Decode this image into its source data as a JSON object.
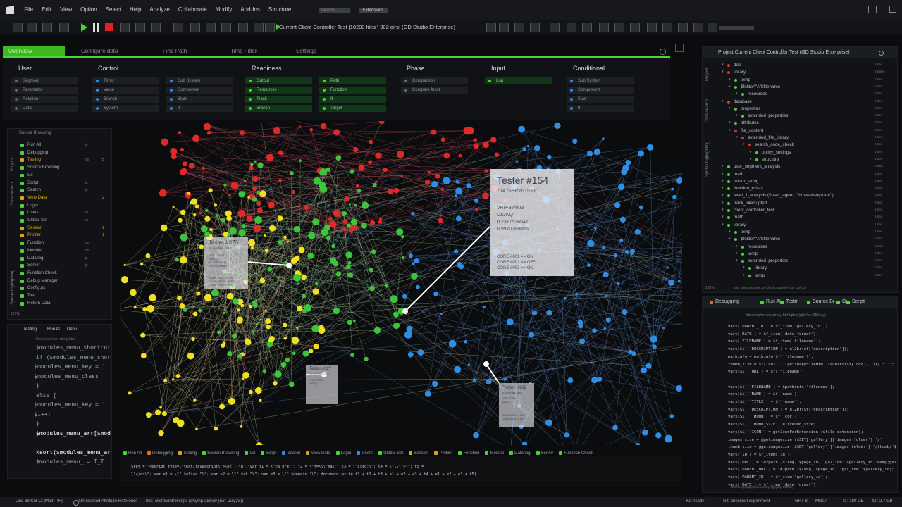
{
  "menu": [
    "File",
    "Edit",
    "View",
    "Option",
    "Select",
    "Help",
    "Analyze",
    "Collaborate",
    "Modify",
    "Add-Ins",
    "Structure"
  ],
  "search_placeholder": "Search",
  "extensions_label": "Extensions",
  "run_info": "Current Client Controller Test  [10293 files \\ 302 dirs]  (GD Studio Enterprise)",
  "tabs": [
    "Overview",
    "Configure data",
    "Find Path",
    "Time Filter",
    "Settings"
  ],
  "filters": {
    "user": {
      "title": "User",
      "items": [
        "Segment",
        "Parameter",
        "Relation",
        "Data"
      ]
    },
    "control": {
      "title": "Control",
      "col1": [
        "Timer",
        "Value",
        "Branch",
        "System"
      ],
      "col2": [
        "Sub System",
        "Component",
        "Start",
        "If"
      ]
    },
    "readiness": {
      "title": "Readiness",
      "col1": [
        "Output",
        "Resources",
        "Track",
        "Branch"
      ],
      "col2": [
        "Path",
        "Function",
        "If",
        "Target"
      ]
    },
    "phase": {
      "title": "Phase",
      "items": [
        "Comparison",
        "Compare funct"
      ]
    },
    "input": {
      "title": "Input",
      "items": [
        "Log"
      ]
    },
    "conditional": {
      "title": "Conditional",
      "items": [
        "Sub System",
        "Component",
        "Start",
        "If"
      ]
    }
  },
  "source_panel": {
    "title": "Source Browsing",
    "side_labels": [
      "Syntax highlighting",
      "Code search",
      "Project"
    ],
    "items": [
      {
        "label": "Run All",
        "color": "#4cd137",
        "tag": "js",
        "count": ""
      },
      {
        "label": "Debugging",
        "color": "#4cd137",
        "tag": "",
        "count": ""
      },
      {
        "label": "Testing",
        "color": "#e0a020",
        "tag": "cs",
        "count": "5"
      },
      {
        "label": "Source Browsing",
        "color": "#4cd137",
        "tag": "",
        "count": ""
      },
      {
        "label": "Git",
        "color": "#4cd137",
        "tag": "",
        "count": ""
      },
      {
        "label": "Script",
        "color": "#4cd137",
        "tag": "js",
        "count": ""
      },
      {
        "label": "Search",
        "color": "#4cd137",
        "tag": "js",
        "count": ""
      },
      {
        "label": "View Data",
        "color": "#e0a020",
        "tag": "",
        "count": "2"
      },
      {
        "label": "Login",
        "color": "#4cd137",
        "tag": "",
        "count": ""
      },
      {
        "label": "Users",
        "color": "#4cd137",
        "tag": "m",
        "count": ""
      },
      {
        "label": "Global Set",
        "color": "#4cd137",
        "tag": "m",
        "count": ""
      },
      {
        "label": "Session",
        "color": "#e0a020",
        "tag": "",
        "count": "1"
      },
      {
        "label": "Profiler",
        "color": "#e0a020",
        "tag": "",
        "count": "1"
      },
      {
        "label": "Function",
        "color": "#4cd137",
        "tag": "cs",
        "count": ""
      },
      {
        "label": "Module",
        "color": "#4cd137",
        "tag": "cs",
        "count": ""
      },
      {
        "label": "Data log",
        "color": "#4cd137",
        "tag": "js",
        "count": ""
      },
      {
        "label": "Server",
        "color": "#4cd137",
        "tag": "js",
        "count": ""
      },
      {
        "label": "Function Check",
        "color": "#4cd137",
        "tag": "",
        "count": ""
      },
      {
        "label": "Debug Manager",
        "color": "#4cd137",
        "tag": "",
        "count": ""
      },
      {
        "label": "Config.px",
        "color": "#4cd137",
        "tag": "",
        "count": ""
      },
      {
        "label": "Test",
        "color": "#4cd137",
        "tag": "",
        "count": ""
      },
      {
        "label": "Return Data",
        "color": "#4cd137",
        "tag": "",
        "count": ""
      }
    ],
    "zoom": "120%"
  },
  "left_code": {
    "tabs": [
      "Testing",
      "Run Al",
      "Debu"
    ],
    "path": "libraries/return string html",
    "lines": [
      "$modules_menu_shortcuts_k",
      "if ($modules_menu_shortcuts_",
      "    $modules_menu_key = '",
      "    $modules_menu_class",
      "}",
      "else {",
      "    $modules_menu_key = '",
      "    $i++;",
      "}",
      "$modules_menu_arr[$module",
      "",
      "ksort($modules_menu_arr, SORT_N",
      "$modules_menu_ = T_T 'sub' N"
    ]
  },
  "graph": {
    "cards": [
      {
        "title": "Tester #154",
        "sub": "Z14 /SERW-1533/",
        "lines": [
          "VRP-37/003",
          "Da3KQ",
          "0.2377536541",
          "0.9970788855"
        ],
        "cores": [
          "CORE #001 >> ON",
          "CORE #002 >> OFF",
          "CORE #003 >> ON"
        ]
      },
      {
        "title": "Tester #073",
        "sub": "Z14 /SERW-1533/",
        "lines": [
          "VRP-37/003",
          "Da3KQ",
          "0.2377536541",
          "0.9970788855"
        ],
        "cores": [
          "CORE #001 >> ON",
          "CORE #002 >> OFF",
          "CORE #003 >> ON"
        ]
      },
      {
        "title": "Tester #327",
        "sub": "Z14 /SERW-1533/",
        "lines": [
          "VRP-37/003",
          "Da3KQ"
        ],
        "cores": []
      },
      {
        "title": "Tester #162",
        "sub": "Z14 /SERW-1533/",
        "lines": [
          "VRP-37/003",
          "Da3KQ"
        ],
        "cores": [
          "CORE #001 >> ON",
          "CORE #002 >> OFF"
        ]
      }
    ]
  },
  "bottom_tabs": [
    "Run All",
    "Debugging",
    "Testing",
    "Source Browsing",
    "Git",
    "Script",
    "Search",
    "View Data",
    "Login",
    "Users",
    "Global Set",
    "Session",
    "Profiler",
    "Function",
    "Module",
    "Data log",
    "Server",
    "Function Check"
  ],
  "bottom_code": [
    "$ret = \"<script type=\\\"text/javascript\\\">\\n<!--\\n\".\"var t1 = \\\"<a hre\\\"; t2 = \\\"f=\\\\\\\"ma\\\"; t3 = \\\"ilto:\\\"; t4 = \\\"\\\\\\\">\\\"; t5 =",
    "\\\"</a>\\\"; var e1 = \\\"\".$alias.\"\\\"; var e2 = \\\"\".$at.\"\\\"; var e3 = \\\"\".$domain.\"\\\"; document.write(t1 + t2 + t3 + e1 + e2 + e3 + t4 + e1 + e2 + e3 + t5)"
  ],
  "project_panel": {
    "title": "Project Current Client Controller Test  (GD Studio Enterprise)",
    "side_labels": [
      "Project",
      "Code search",
      "Syntax highlighting"
    ],
    "tree": [
      {
        "label": "doc",
        "indent": 0,
        "color": "#e03030",
        "count": "1 sec"
      },
      {
        "label": "library",
        "indent": 0,
        "color": "#e03030",
        "count": "2 msec"
      },
      {
        "label": "temp",
        "indent": 1,
        "color": "#4cd137",
        "count": "1 sec"
      },
      {
        "label": "$folder\\\"/\\\"$filename",
        "indent": 1,
        "color": "#4cd137",
        "count": "1 sec"
      },
      {
        "label": "resourses",
        "indent": 2,
        "color": "#4cd137",
        "count": "1 sec"
      },
      {
        "label": "database",
        "indent": 0,
        "color": "#e03030",
        "count": "1 sec"
      },
      {
        "label": "properties",
        "indent": 1,
        "color": "#4cd137",
        "count": "1 sec"
      },
      {
        "label": "extended_properties",
        "indent": 2,
        "color": "#4cd137",
        "count": "1 sec"
      },
      {
        "label": "attributes",
        "indent": 1,
        "color": "#4cd137",
        "count": "4 sec"
      },
      {
        "label": "file_content",
        "indent": 1,
        "color": "#e03030",
        "count": "1 sec"
      },
      {
        "label": "extended_file_library",
        "indent": 2,
        "color": "#e03030",
        "count": "1 sec"
      },
      {
        "label": "search_code_check",
        "indent": 3,
        "color": "#e03030",
        "count": "6 sec"
      },
      {
        "label": "policy_settings",
        "indent": 4,
        "color": "#4cd137",
        "count": "1 sec"
      },
      {
        "label": "structure",
        "indent": 4,
        "color": "#4cd137",
        "count": "1 sec"
      },
      {
        "label": "user_segment_analysis",
        "indent": 0,
        "color": "#4cd137",
        "count": "5 msc"
      },
      {
        "label": "math",
        "indent": 0,
        "color": "#4cd137",
        "count": "1 sec"
      },
      {
        "label": "return_string",
        "indent": 0,
        "color": "#4cd137",
        "count": "1 sec"
      },
      {
        "label": "function_exists",
        "indent": 0,
        "color": "#4cd137",
        "count": "1 sec"
      },
      {
        "label": "level_1_analysis ($user_agent, \"ibm-webexplorer\")",
        "indent": 0,
        "color": "#4cd137",
        "count": "1 sec"
      },
      {
        "label": "track_interrupted",
        "indent": 0,
        "color": "#4cd137",
        "count": "1 sec"
      },
      {
        "label": "client_controller_test",
        "indent": 0,
        "color": "#4cd137",
        "count": "1 sec"
      },
      {
        "label": "math",
        "indent": 0,
        "color": "#4cd137",
        "count": "1 sec"
      },
      {
        "label": "library",
        "indent": 0,
        "color": "#4cd137",
        "count": "1 sec"
      },
      {
        "label": "temp",
        "indent": 1,
        "color": "#4cd137",
        "count": "1 sec"
      },
      {
        "label": "$folder\\\"/\\\"$filename",
        "indent": 1,
        "color": "#4cd137",
        "count": "1 sec"
      },
      {
        "label": "resourses",
        "indent": 2,
        "color": "#4cd137",
        "count": "6 msc"
      },
      {
        "label": "temp",
        "indent": 2,
        "color": "#4cd137",
        "count": "1 sec"
      },
      {
        "label": "extended_properties",
        "indent": 2,
        "color": "#4cd137",
        "count": "1 sec"
      },
      {
        "label": "library",
        "indent": 3,
        "color": "#4cd137",
        "count": "1 sec"
      },
      {
        "label": "temp",
        "indent": 3,
        "color": "#4cd137",
        "count": "1 sec"
      }
    ],
    "footer": "test_clientcontroller.px (ghy/hp-25\\hay) [run_July23]",
    "zoom": "120%"
  },
  "right_code": {
    "tabs": [
      "Debugging",
      "Run Al",
      "Testin",
      "Source Br",
      "Gi",
      "Script"
    ],
    "path": "libraries/return string.html.php (ghy/hp-25\\hay)",
    "lines": [
      "vars['PARENT_ID'] = $f_item['gallery_id'];",
      "vars['DATE'] = $f_item['date_format'];",
      "vars['FILENAME'] = $f_item['filename'];",
      "vars[$i]['DESCRIPTION'] = nl2br($f['description']);",
      "pathinfo = pathinfo($f['filename']);",
      "thumb_size = $f['cor'] ? getImageSizeHtml (substr($f['cor'], 1)) : '';",
      "vars[$i]['URL'] = $f['filename'];",
      "",
      "vars[$i]['FILENAME'] = $pathinfo['filename'];",
      "vars[$i]['NAME'] = $f['name'];",
      "vars[$i]['TITLE'] = $f['name'];",
      "vars[$i]['DESCRIPTION'] = nl2br($f['description']);",
      "vars[$i]['THUMB'] = $f['cor'];",
      "vars[$i]['THUMB_SIZE'] = $thumb_size;",
      "vars[$i]['ICON'] = getIconForExtension ($file_extension);",
      "images_size = @getimagesize ($SET['gallery']['images_folder'] '/'",
      "thumb_size = @getimagesize ($SET['gallery']['images_folder'] '/thumb/'$f_item",
      "vars['ID'] = $f_item['id'];",
      "vars['URL'] = id2path ($lang, $page_id, 'gal_id='.$gallery_id.'&amp;gal",
      "vars['PARENT_URL'] = id2path ($lang, $page_id, 'gal_id='.$gallery_id);",
      "vars['PARENT_ID'] = $f_item['gallery_id'];",
      "vars['DATE'] = $f_item['date_format'];"
    ],
    "footer": "libraries/geoip/geoip.inc.php (ghy/hp-25\\hay)"
  },
  "status": {
    "line_col": "Line 89 Col 12 [Main PH]",
    "warning": "Unresolved Attribute Reference",
    "file": "test_clientcontroller.px (ghy/hp-25\\hay (run_July23))",
    "kit": "Kit: ready",
    "git": "Git: checkout experiment",
    "ght": "GHT-8",
    "mr": "MR07",
    "c": "C : 180 GB",
    "m": "M : 2.7 GB"
  },
  "colors": {
    "accent": "#4cd137",
    "red": "#e03030",
    "blue": "#2f8de4",
    "yellow": "#f0e020"
  }
}
